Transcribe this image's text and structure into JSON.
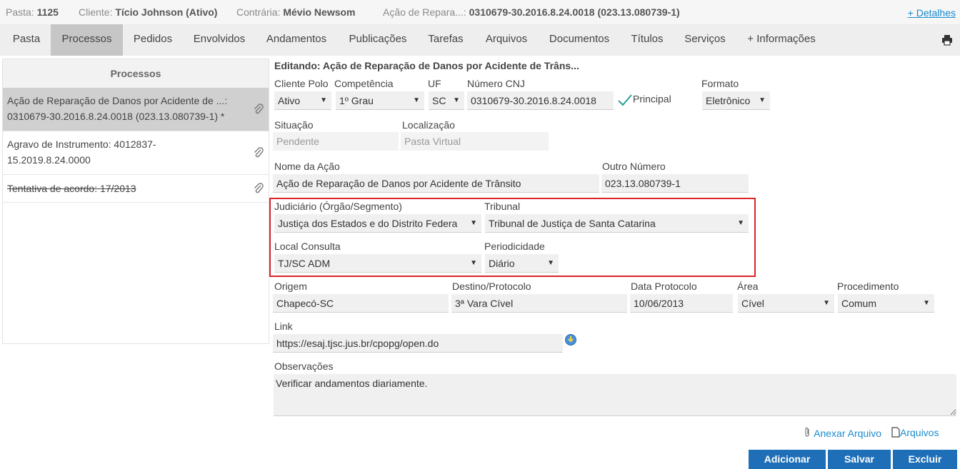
{
  "header": {
    "pasta_label": "Pasta:",
    "pasta_value": "1125",
    "cliente_label": "Cliente:",
    "cliente_value": "Tício Johnson (Ativo)",
    "contraria_label": "Contrária:",
    "contraria_value": "Mévio Newsom",
    "acao_label": "Ação de Repara...:",
    "acao_value": "0310679-30.2016.8.24.0018 (023.13.080739-1)",
    "details_link": "+ Detalhes"
  },
  "nav": {
    "tabs": [
      "Pasta",
      "Processos",
      "Pedidos",
      "Envolvidos",
      "Andamentos",
      "Publicações",
      "Tarefas",
      "Arquivos",
      "Documentos",
      "Títulos",
      "Serviços",
      "+ Informações"
    ],
    "active": "Processos"
  },
  "left": {
    "title": "Processos",
    "items": [
      {
        "line1": "Ação de Reparação de Danos por Acidente de ...:",
        "line2": "0310679-30.2016.8.24.0018 (023.13.080739-1) *"
      },
      {
        "line1": "Agravo de Instrumento: 4012837-",
        "line2": "15.2019.8.24.0000"
      },
      {
        "line1": "Tentativa de acordo: 17/2013"
      }
    ]
  },
  "form": {
    "title": "Editando: Ação de Reparação de Danos por Acidente de Trâns...",
    "cliente_polo": {
      "label": "Cliente Polo",
      "value": "Ativo"
    },
    "competencia": {
      "label": "Competência",
      "value": "1º Grau"
    },
    "uf": {
      "label": "UF",
      "value": "SC"
    },
    "numero_cnj": {
      "label": "Número CNJ",
      "value": "0310679-30.2016.8.24.0018"
    },
    "principal": "Principal",
    "formato": {
      "label": "Formato",
      "value": "Eletrônico"
    },
    "situacao": {
      "label": "Situação",
      "value": "Pendente"
    },
    "localizacao": {
      "label": "Localização",
      "value": "Pasta Virtual"
    },
    "nome_acao": {
      "label": "Nome da Ação",
      "value": "Ação de Reparação de Danos por Acidente de Trânsito"
    },
    "outro_numero": {
      "label": "Outro Número",
      "value": "023.13.080739-1"
    },
    "judiciario": {
      "label": "Judiciário (Órgão/Segmento)",
      "value": "Justiça dos Estados e do Distrito Federa"
    },
    "tribunal": {
      "label": "Tribunal",
      "value": "Tribunal de Justiça de Santa Catarina"
    },
    "local_consulta": {
      "label": "Local Consulta",
      "value": "TJ/SC ADM"
    },
    "periodicidade": {
      "label": "Periodicidade",
      "value": "Diário"
    },
    "origem": {
      "label": "Origem",
      "value": "Chapecó-SC"
    },
    "destino": {
      "label": "Destino/Protocolo",
      "value": "3ª Vara Cível"
    },
    "data_protocolo": {
      "label": "Data Protocolo",
      "value": "10/06/2013"
    },
    "area": {
      "label": "Área",
      "value": "Cível"
    },
    "procedimento": {
      "label": "Procedimento",
      "value": "Comum"
    },
    "link": {
      "label": "Link",
      "value": "https://esaj.tjsc.jus.br/cpopg/open.do"
    },
    "observacoes": {
      "label": "Observações",
      "value": "Verificar andamentos diariamente."
    }
  },
  "footer": {
    "anexar": "Anexar Arquivo",
    "arquivos": "Arquivos",
    "adicionar": "Adicionar",
    "salvar": "Salvar",
    "excluir": "Excluir"
  },
  "colors": {
    "accent": "#1a8ccf",
    "button": "#1f6fb8",
    "highlight": "#d9242a",
    "check": "#2aa198"
  }
}
